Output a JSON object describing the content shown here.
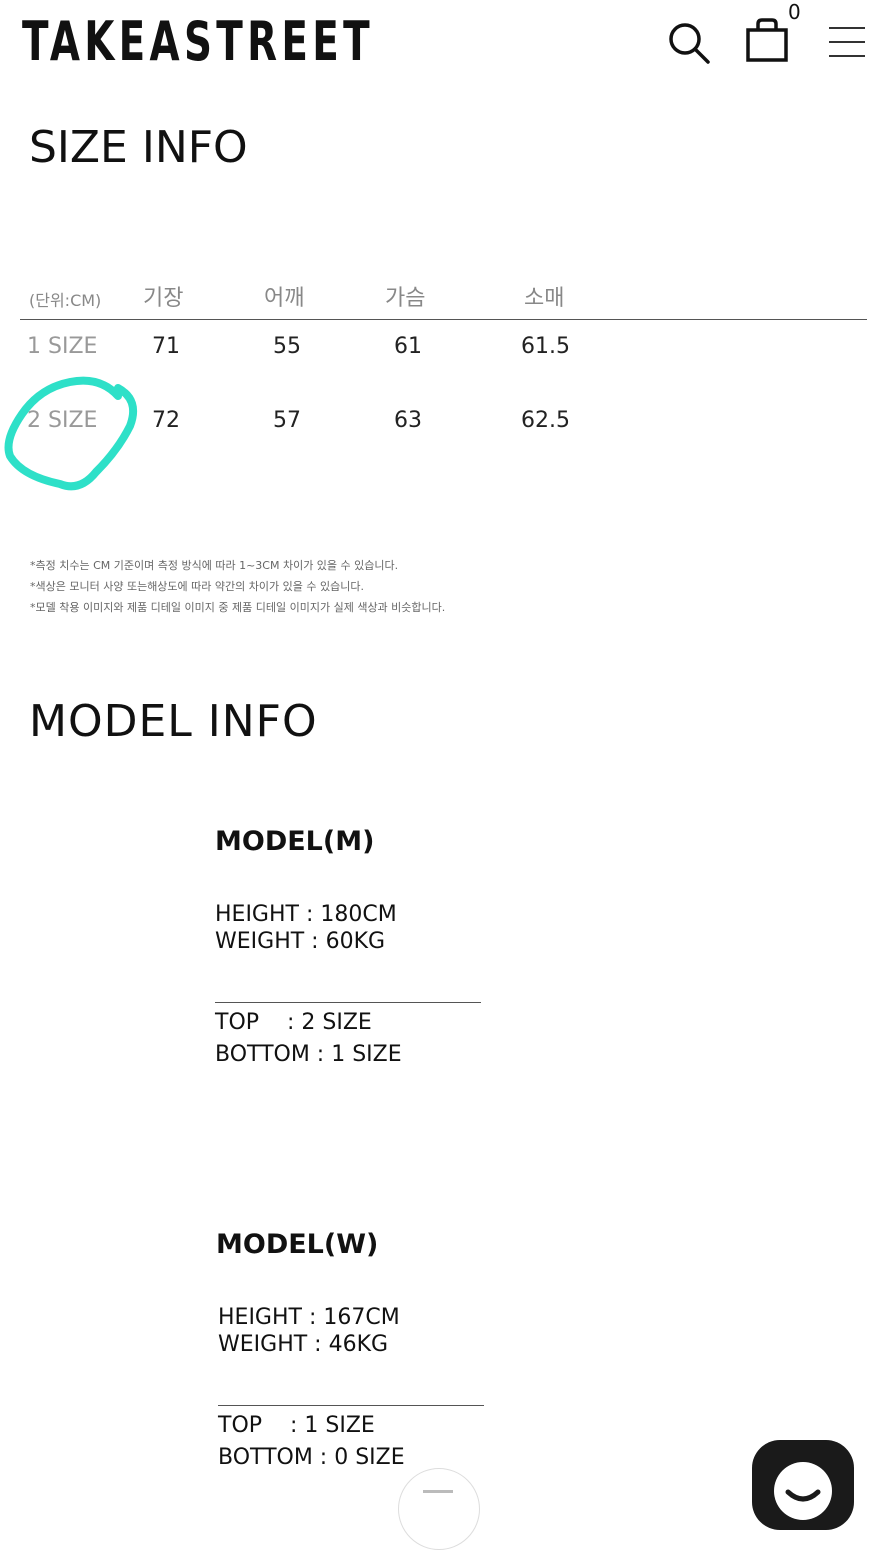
{
  "header": {
    "logo": "TAKEASTREET",
    "cart_count": "0",
    "icons": [
      "search-icon",
      "shopping-bag-icon",
      "menu-icon"
    ]
  },
  "size_info": {
    "title": "SIZE INFO",
    "columns": [
      "(단위:CM)",
      "기장",
      "어깨",
      "가슴",
      "소매"
    ],
    "rows": [
      {
        "label": "1 SIZE",
        "values": [
          "71",
          "55",
          "61",
          "61.5"
        ]
      },
      {
        "label": "2 SIZE",
        "values": [
          "72",
          "57",
          "63",
          "62.5"
        ]
      }
    ],
    "highlight_color": "#2ee0c8",
    "notes": [
      "*측정 치수는 CM 기준이며 측정 방식에 따라 1~3CM 차이가 있을 수 있습니다.",
      "*색상은 모니터 사양 또는해상도에 따라 약간의 차이가 있을 수 있습니다.",
      "*모델 착용 이미지와 제품 디테일 이미지 중 제품 디테일 이미지가 실제 색상과 비슷합니다."
    ]
  },
  "model_info": {
    "title": "MODEL INFO",
    "models": [
      {
        "name": "MODEL(M)",
        "height": "HEIGHT : 180CM",
        "weight": "WEIGHT : 60KG",
        "top": "TOP    : 2 SIZE",
        "bottom": "BOTTOM : 1 SIZE"
      },
      {
        "name": "MODEL(W)",
        "height": "HEIGHT : 167CM",
        "weight": "WEIGHT : 46KG",
        "top": "TOP    : 1 SIZE",
        "bottom": "BOTTOM : 0 SIZE"
      }
    ]
  }
}
